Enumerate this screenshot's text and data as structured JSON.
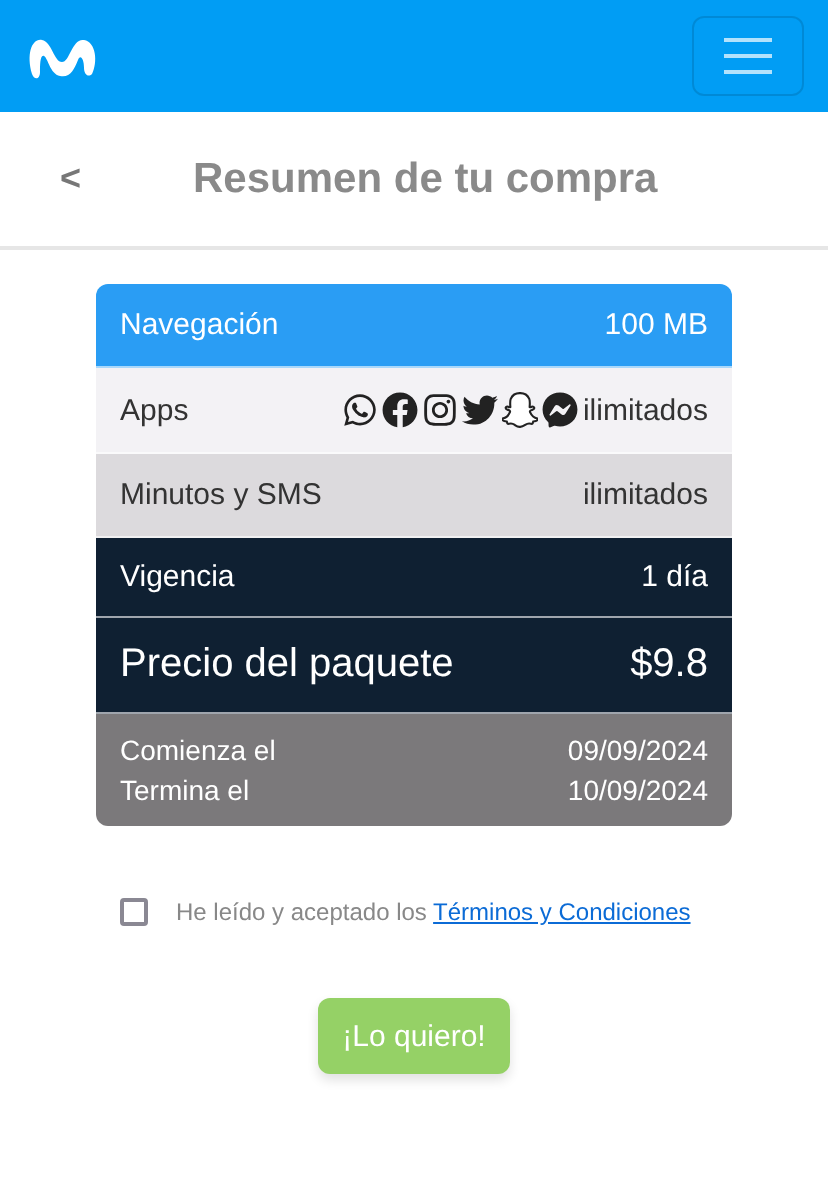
{
  "header": {
    "menu_button": {
      "expanded": false
    }
  },
  "title_bar": {
    "back": "<",
    "title": "Resumen de tu compra"
  },
  "summary": {
    "rows": [
      {
        "kind": "data",
        "label": "Navegación",
        "value": "100 MB",
        "color": "#2a9df4"
      },
      {
        "kind": "apps",
        "label": "Apps",
        "value": "ilimitados",
        "color": "#f3f2f5"
      },
      {
        "kind": "data",
        "label": "Minutos y SMS",
        "value": "ilimitados",
        "color": "#dcdadd"
      },
      {
        "kind": "data",
        "label": "Vigencia",
        "value": "1 día",
        "color": "#0f2032"
      },
      {
        "kind": "price",
        "label": "Precio del paquete",
        "value": "$9.8",
        "color": "#0f2032"
      }
    ],
    "dates": [
      {
        "label": "Comienza el",
        "value": "09/09/2024"
      },
      {
        "label": "Termina el",
        "value": "10/09/2024"
      }
    ]
  },
  "terms": {
    "checked": false,
    "text": "He leído y aceptado los",
    "link": "Términos y Condiciones"
  },
  "submit": "¡Lo quiero!"
}
